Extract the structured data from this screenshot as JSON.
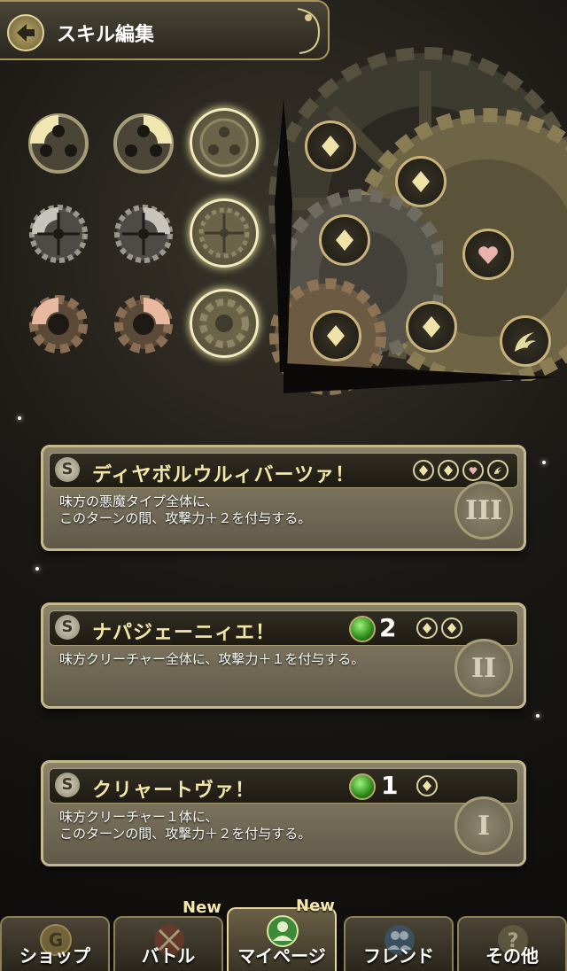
{
  "header": {
    "title": "スキル編集",
    "back_icon": "back-arrow-icon"
  },
  "skills": [
    {
      "badge": "S",
      "name": "ディヤボルウルィバーツァ！",
      "description": "味方の悪魔タイプ全体に、\nこのターンの間、攻撃力＋２を付与する。",
      "cost_icons": [
        "diamond-icon",
        "diamond-icon",
        "heart-icon",
        "demon-wing-icon"
      ],
      "mana": null,
      "level": "III"
    },
    {
      "badge": "S",
      "name": "ナパジェーニィエ！",
      "description": "味方クリーチャー全体に、攻撃力＋１を付与する。",
      "cost_icons": [
        "diamond-icon",
        "diamond-icon"
      ],
      "mana": "2",
      "level": "II"
    },
    {
      "badge": "S",
      "name": "クリャートヴァ！",
      "description": "味方クリーチャー１体に、\nこのターンの間、攻撃力＋２を付与する。",
      "cost_icons": [
        "diamond-icon"
      ],
      "mana": "1",
      "level": "I"
    }
  ],
  "nav": [
    {
      "label": "ショップ",
      "icon": "coin-g-icon",
      "new": ""
    },
    {
      "label": "バトル",
      "icon": "crossed-swords-icon",
      "new": "New"
    },
    {
      "label": "マイページ",
      "icon": "user-icon",
      "new": "New",
      "active": true
    },
    {
      "label": "フレンド",
      "icon": "friends-icon",
      "new": ""
    },
    {
      "label": "その他",
      "icon": "question-icon",
      "new": ""
    }
  ],
  "colors": {
    "accent": "#f2e6a8",
    "frame": "#c5b98c",
    "mana_green": "#2f8a1a"
  }
}
